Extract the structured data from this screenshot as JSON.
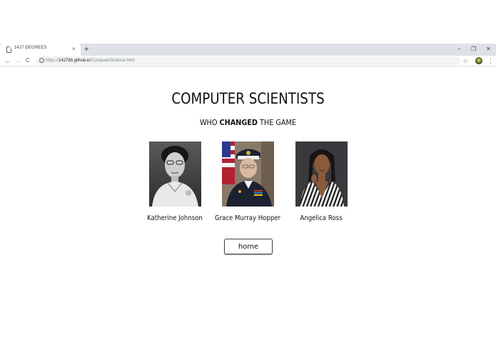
{
  "browser": {
    "tab_title": "1427 DEGREES",
    "tab_close": "×",
    "new_tab": "+",
    "window_minimize": "–",
    "window_restore": "❐",
    "window_close": "✕",
    "back": "←",
    "forward": "→",
    "reload": "C",
    "url_scheme": "https://",
    "url_host": "1427ttb.github.io",
    "url_path": "/ComputerScience.html",
    "bookmark_star": "☆",
    "menu": "⋮"
  },
  "page": {
    "title": "COMPUTER SCIENTISTS",
    "subtitle_pre": "WHO ",
    "subtitle_bold": "CHANGED",
    "subtitle_post": " THE GAME"
  },
  "people": [
    {
      "name": "Katherine Johnson"
    },
    {
      "name": "Grace Murray Hopper"
    },
    {
      "name": "Angelica Ross"
    }
  ],
  "home_button": {
    "label": "home"
  }
}
